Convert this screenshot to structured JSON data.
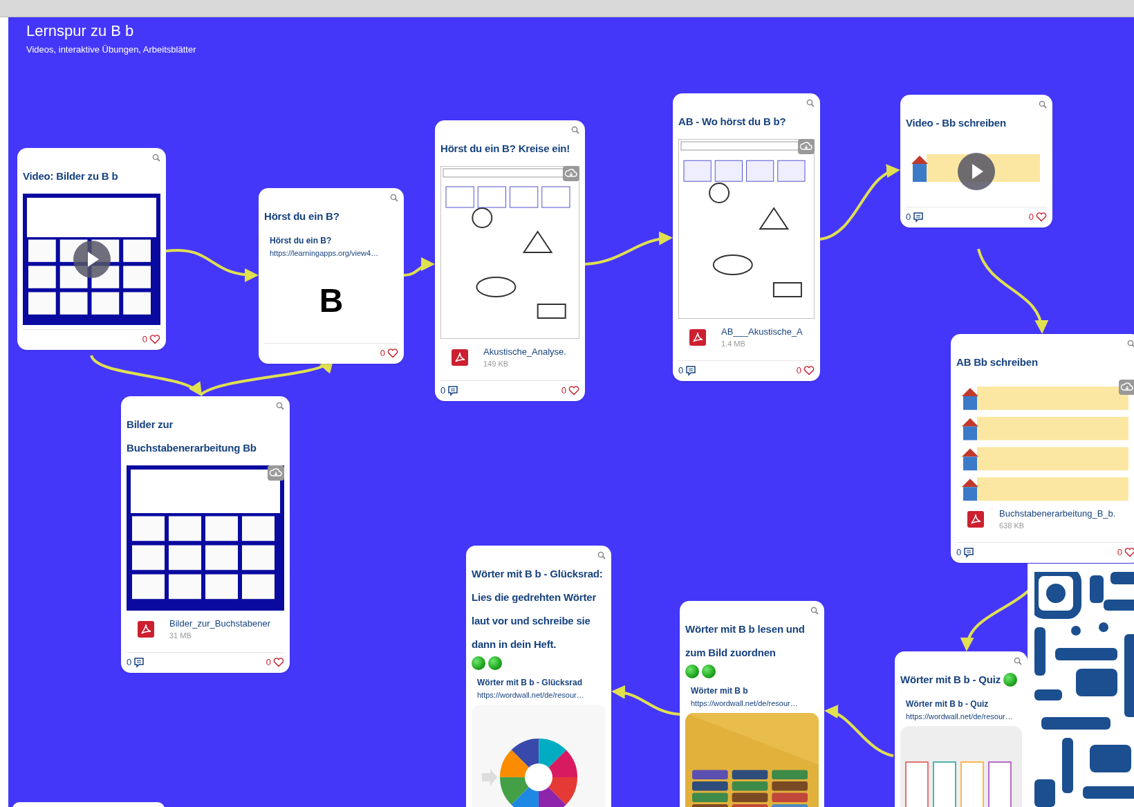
{
  "board": {
    "title": "Lernspur zu B b",
    "subtitle": "Videos, interaktive Übungen, Arbeitsblätter"
  },
  "cards": [
    {
      "kind": "video",
      "title": "Video: Bilder zu B b",
      "likes": "0"
    },
    {
      "kind": "link",
      "title": "Hörst du ein B?",
      "link_title": "Hörst du ein B?",
      "url": "https://learningapps.org/view4…",
      "preview_letter": "B",
      "likes": "0"
    },
    {
      "kind": "file",
      "title": "Hörst du ein B? Kreise ein!",
      "file_name": "Akustische_Analyse.",
      "file_size": "149 KB",
      "comments": "0",
      "likes": "0"
    },
    {
      "kind": "file",
      "title": "AB - Wo hörst du B b?",
      "file_name": "AB___Akustische_A",
      "file_size": "1.4 MB",
      "comments": "0",
      "likes": "0"
    },
    {
      "kind": "video",
      "title": "Video - Bb schreiben",
      "comments": "0",
      "likes": "0"
    },
    {
      "kind": "file",
      "title": "AB Bb schreiben",
      "file_name": "Buchstabenerarbeitung_B_b.",
      "file_size": "638 KB",
      "comments": "0",
      "likes": "0"
    },
    {
      "kind": "file",
      "title": "Bilder zur Buchstabenerarbeitung Bb",
      "file_name": "Bilder_zur_Buchstabener",
      "file_size": "31 MB",
      "comments": "0",
      "likes": "0"
    },
    {
      "kind": "link",
      "title": "Wörter mit B b - Glücksrad: Lies die gedrehten Wörter laut vor und schreibe sie dann in dein Heft.",
      "dots": [
        {
          "kind": "green"
        },
        {
          "kind": "green"
        }
      ],
      "link_title": "Wörter mit B b - Glücksrad",
      "url": "https://wordwall.net/de/resour…"
    },
    {
      "kind": "link",
      "title": "Wörter mit B b lesen und zum Bild zuordnen",
      "dots": [
        {
          "kind": "green"
        },
        {
          "kind": "green"
        }
      ],
      "link_title": "Wörter mit B b",
      "url": "https://wordwall.net/de/resour…"
    },
    {
      "kind": "link",
      "title": "Wörter mit B b - Quiz",
      "dots": [
        {
          "kind": "green"
        }
      ],
      "link_title": "Wörter mit B b - Quiz",
      "url": "https://wordwall.net/de/resour…"
    }
  ]
}
